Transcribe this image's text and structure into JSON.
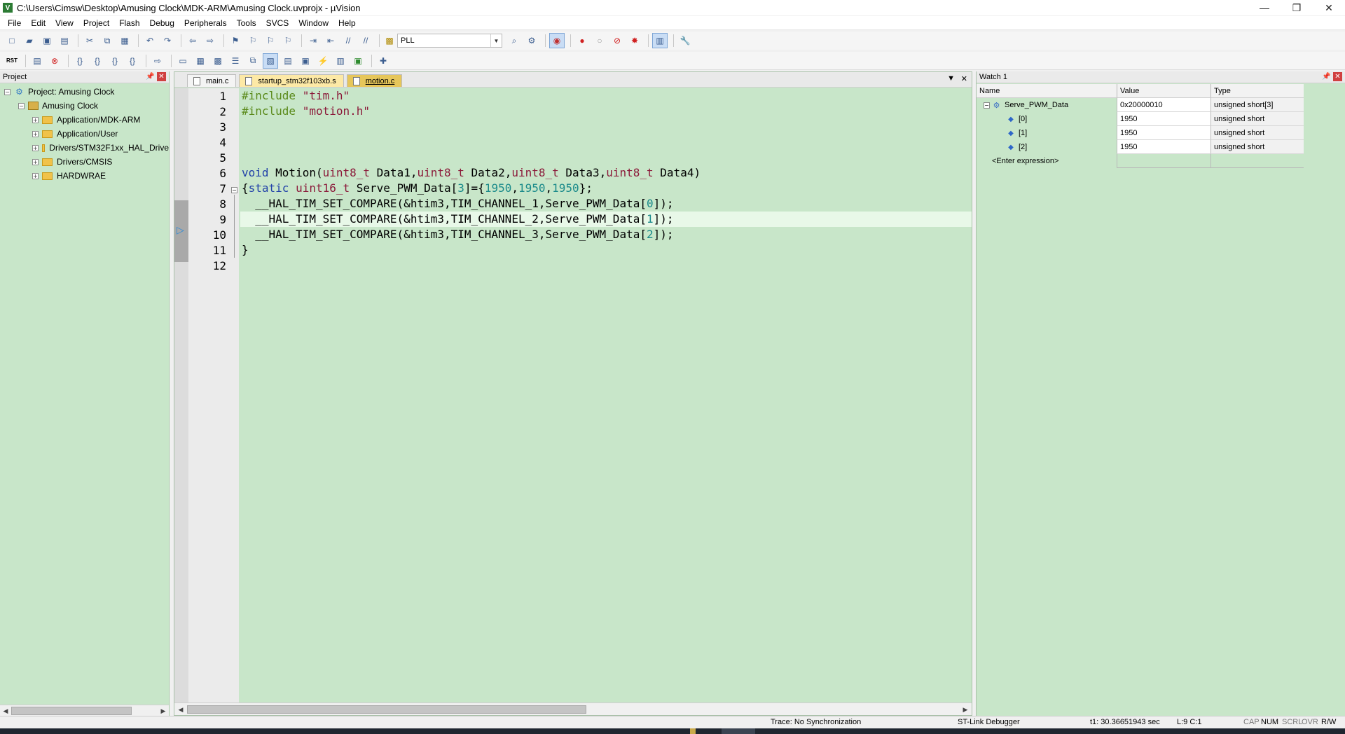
{
  "window": {
    "title": "C:\\Users\\Cimsw\\Desktop\\Amusing Clock\\MDK-ARM\\Amusing Clock.uvprojx - µVision",
    "app_icon": "uvision-icon",
    "minimize": "—",
    "maximize": "❐",
    "close": "✕"
  },
  "menu": [
    "File",
    "Edit",
    "View",
    "Project",
    "Flash",
    "Debug",
    "Peripherals",
    "Tools",
    "SVCS",
    "Window",
    "Help"
  ],
  "toolbar": {
    "target_combo": "PLL",
    "rst_label": "RST"
  },
  "project_panel": {
    "title": "Project",
    "tree": {
      "root": "Project: Amusing Clock",
      "target": "Amusing Clock",
      "groups": [
        "Application/MDK-ARM",
        "Application/User",
        "Drivers/STM32F1xx_HAL_Drive",
        "Drivers/CMSIS",
        "HARDWRAE"
      ]
    }
  },
  "editor": {
    "tabs": [
      {
        "label": "main.c",
        "active": false
      },
      {
        "label": "startup_stm32f103xb.s",
        "active": false
      },
      {
        "label": "motion.c",
        "active": true
      }
    ],
    "line_numbers": [
      "1",
      "2",
      "3",
      "4",
      "5",
      "6",
      "7",
      "8",
      "9",
      "10",
      "11",
      "12"
    ],
    "current_line": 9,
    "code": {
      "l1_pp": "#include",
      "l1_str": "\"tim.h\"",
      "l2_pp": "#include",
      "l2_str": "\"motion.h\"",
      "l6": {
        "void": "void",
        "fn": " Motion(",
        "t1": "uint8_t",
        "a1": " Data1,",
        "t2": "uint8_t",
        "a2": " Data2,",
        "t3": "uint8_t",
        "a3": " Data3,",
        "t4": "uint8_t",
        "a4": " Data4)"
      },
      "l7": {
        "brace": "{",
        "static": "static",
        "sp": " ",
        "type": "uint16_t",
        "decl": " Serve_PWM_Data[",
        "size": "3",
        "mid": "]={",
        "v1": "1950",
        "c1": ",",
        "v2": "1950",
        "c2": ",",
        "v3": "1950",
        "end": "};"
      },
      "l8": {
        "pre": "  __HAL_TIM_SET_COMPARE(&htim3,TIM_CHANNEL_1,Serve_PWM_Data[",
        "idx": "0",
        "post": "]);"
      },
      "l9": {
        "pre": "  __HAL_TIM_SET_COMPARE(&htim3,TIM_CHANNEL_2,Serve_PWM_Data[",
        "idx": "1",
        "post": "]);"
      },
      "l10": {
        "pre": "  __HAL_TIM_SET_COMPARE(&htim3,TIM_CHANNEL_3,Serve_PWM_Data[",
        "idx": "2",
        "post": "]);"
      },
      "l11": "}"
    }
  },
  "watch": {
    "title": "Watch 1",
    "columns": {
      "name": "Name",
      "value": "Value",
      "type": "Type"
    },
    "variable": {
      "name": "Serve_PWM_Data",
      "value": "0x20000010",
      "type": "unsigned short[3]"
    },
    "elements": [
      {
        "name": "[0]",
        "value": "1950",
        "type": "unsigned short"
      },
      {
        "name": "[1]",
        "value": "1950",
        "type": "unsigned short"
      },
      {
        "name": "[2]",
        "value": "1950",
        "type": "unsigned short"
      }
    ],
    "enter_expression": "<Enter expression>"
  },
  "status": {
    "trace": "Trace: No Synchronization",
    "debugger": "ST-Link Debugger",
    "time": "t1: 30.36651943 sec",
    "position": "L:9 C:1",
    "cap": "CAP",
    "num": "NUM",
    "scrl": "SCRL",
    "ovr": "OVR",
    "rw": "R/W"
  },
  "colors": {
    "editor_bg": "#c8e6c9",
    "keyword": "#1f3fa8",
    "type": "#8b1a3a",
    "preprocessor": "#5a8a1a",
    "number": "#1a8a8a"
  }
}
